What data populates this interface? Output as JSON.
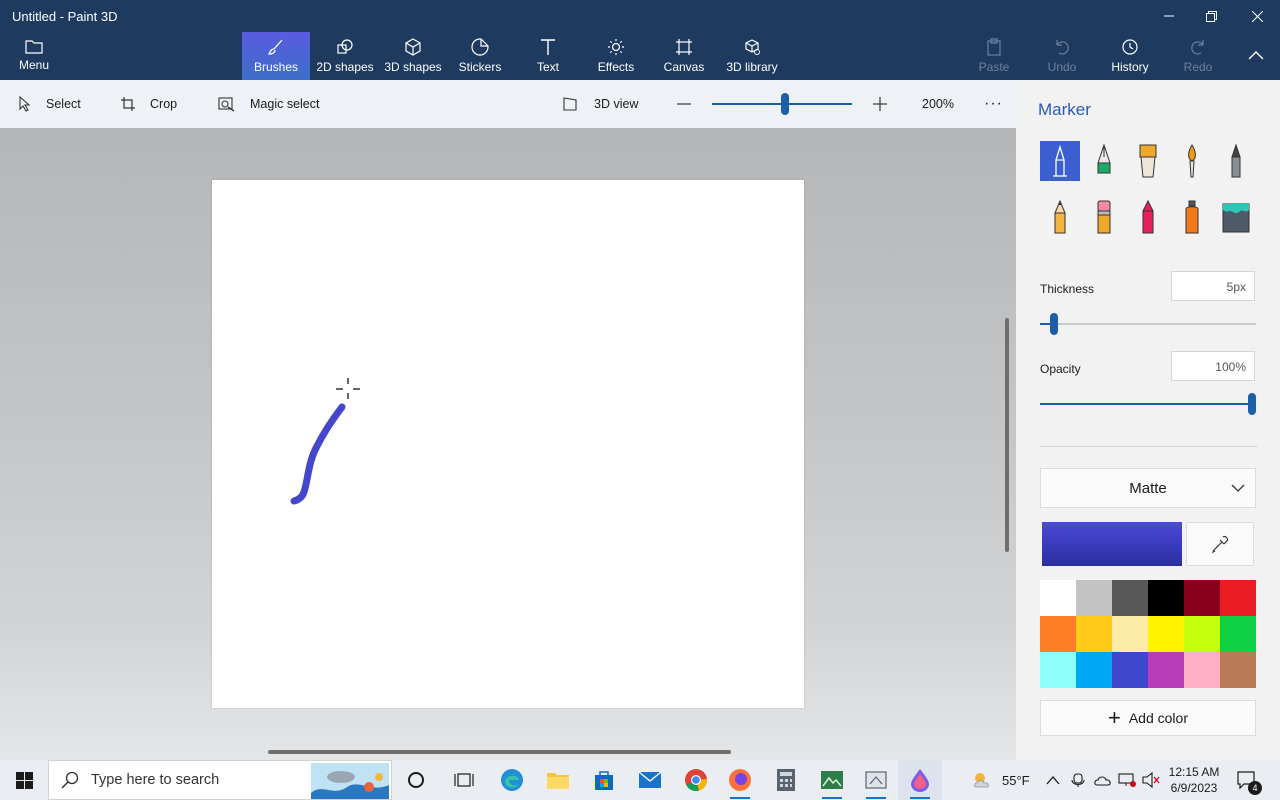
{
  "window": {
    "title": "Untitled - Paint 3D"
  },
  "ribbon": {
    "menu": "Menu",
    "tabs": [
      "Brushes",
      "2D shapes",
      "3D shapes",
      "Stickers",
      "Text",
      "Effects",
      "Canvas",
      "3D library"
    ],
    "active_tab": "Brushes",
    "actions": {
      "paste": "Paste",
      "undo": "Undo",
      "history": "History",
      "redo": "Redo"
    }
  },
  "toolbar": {
    "select": "Select",
    "crop": "Crop",
    "magic_select": "Magic select",
    "view_3d": "3D view",
    "zoom": "200%",
    "zoom_fraction": 0.52
  },
  "panel": {
    "title": "Marker",
    "brushes": [
      "marker",
      "calligraphy-pen",
      "oil-brush",
      "watercolor",
      "pixel-pen",
      "pencil",
      "eraser",
      "crayon",
      "spray-can",
      "fill-bucket"
    ],
    "selected_brush": "marker",
    "thickness_label": "Thickness",
    "thickness_value": "5px",
    "thickness_fraction": 0.05,
    "opacity_label": "Opacity",
    "opacity_value": "100%",
    "opacity_fraction": 1.0,
    "finish": "Matte",
    "current_color": "#4a4ad8",
    "palette": [
      "#ffffff",
      "#c3c3c3",
      "#585858",
      "#000000",
      "#88001b",
      "#ec1c24",
      "#ff7f27",
      "#ffca18",
      "#fdeca6",
      "#fff200",
      "#c4ff0e",
      "#0ed145",
      "#8cfffb",
      "#00a8f3",
      "#3f48cc",
      "#b83dba",
      "#ffaec8",
      "#b97a56"
    ],
    "add_color": "Add color"
  },
  "taskbar": {
    "search_placeholder": "Type here to search",
    "weather": "55°F",
    "time": "12:15 AM",
    "date": "6/9/2023",
    "notifications": "4"
  }
}
